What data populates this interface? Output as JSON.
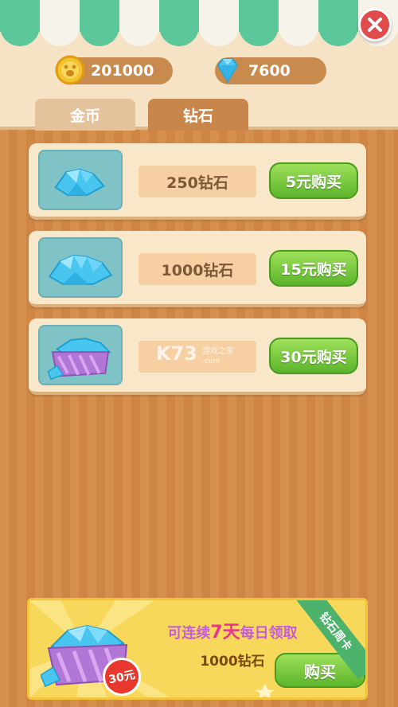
{
  "header": {
    "coins": "201000",
    "diamonds": "7600"
  },
  "tabs": [
    {
      "label": "金币",
      "active": false
    },
    {
      "label": "钻石",
      "active": true
    }
  ],
  "offers": [
    {
      "amount": "250钻石",
      "button": "5元购买"
    },
    {
      "amount": "1000钻石",
      "button": "15元购买"
    },
    {
      "amount": "",
      "button": "30元购买"
    }
  ],
  "banner": {
    "line1_prefix": "可连续",
    "line1_big": "7天",
    "line1_suffix": "每日领取",
    "line2": "1000钻石",
    "price_tag": "30元",
    "ribbon": "钻石周卡",
    "button": "购买"
  },
  "colors": {
    "button_green": "#5bb52b",
    "card_bg": "#f8e7c9",
    "panel_bg": "#f6e2c4"
  }
}
